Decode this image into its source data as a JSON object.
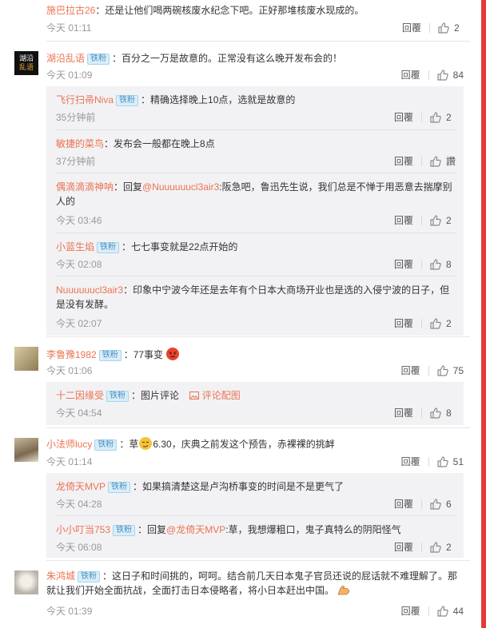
{
  "comments": [
    {
      "user": "施巴拉古26",
      "badge": "",
      "text": "：还是让他们喝两碗核废水纪念下吧。正好那堆核废水现成的。",
      "time": "今天 01:11",
      "reply_label": "回覆",
      "likes": "2"
    },
    {
      "user": "湖沿乱语",
      "badge": "铁粉",
      "avatar_text": [
        "湖沿",
        "乱语"
      ],
      "text": "：百分之一万是故意的。正常没有这么晚开发布会的！",
      "time": "今天 01:09",
      "reply_label": "回覆",
      "likes": "84",
      "replies": [
        {
          "user": "飞行扫帚Niva",
          "badge": "铁粉",
          "text": "：精确选择晚上10点，选就是故意的",
          "time": "35分钟前",
          "reply_label": "回覆",
          "likes": "2"
        },
        {
          "user": "敏捷的菜鸟",
          "badge": "",
          "text": "：发布会一般都在晚上8点",
          "time": "37分钟前",
          "reply_label": "回覆",
          "likes": "讚"
        },
        {
          "user": "偶滴滴滴神呐",
          "badge": "",
          "prefix": "：回复",
          "mention": "@Nuuuuuucl3air3",
          "text": ":阪急吧，鲁迅先生说，我们总是不惮于用恶意去揣摩别人的",
          "time": "今天 03:46",
          "reply_label": "回覆",
          "likes": "2"
        },
        {
          "user": "小蓝生焰",
          "badge": "铁粉",
          "text": "：七七事变就是22点开始的",
          "time": "今天 02:08",
          "reply_label": "回覆",
          "likes": "8"
        },
        {
          "user": "Nuuuuuucl3air3",
          "badge": "",
          "text": "：印象中宁波今年还是去年有个日本大商场开业也是选的入侵宁波的日子，但是没有发酵。",
          "time": "今天 02:07",
          "reply_label": "回覆",
          "likes": "2"
        }
      ]
    },
    {
      "user": "李鲁豫1982",
      "badge": "铁粉",
      "text": "：77事变",
      "time": "今天 01:06",
      "reply_label": "回覆",
      "likes": "75",
      "replies": [
        {
          "user": "十二因缘受",
          "badge": "铁粉",
          "text": "：图片评论",
          "pic_link": "评论配图",
          "time": "今天 04:54",
          "reply_label": "回覆",
          "likes": "8"
        }
      ]
    },
    {
      "user": "小法师lucy",
      "badge": "铁粉",
      "text_a": "：草",
      "text_b": "6.30，庆典之前发这个预告，赤裸裸的挑衅",
      "time": "今天 01:14",
      "reply_label": "回覆",
      "likes": "51",
      "replies": [
        {
          "user": "龙倚天MVP",
          "badge": "铁粉",
          "text": "：如果搞清楚这是卢沟桥事变的时间是不是更气了",
          "time": "今天 04:28",
          "reply_label": "回覆",
          "likes": "6"
        },
        {
          "user": "小小叮当753",
          "badge": "铁粉",
          "prefix": "：回复",
          "mention": "@龙倚天MVP",
          "text": ":草，我想爆粗口，鬼子真特么的阴阳怪气",
          "time": "今天 06:08",
          "reply_label": "回覆",
          "likes": "2"
        }
      ]
    },
    {
      "user": "朱鸿城",
      "badge": "铁粉",
      "text": "：这日子和时间挑的，呵呵。结合前几天日本鬼子官员还说的屁话就不难理解了。那就让我们开始全面抗战，全面打击日本侵略者，将小日本赶出中国。",
      "time": "今天 01:39",
      "reply_label": "回覆",
      "likes": "44"
    }
  ],
  "colors": {
    "username": "#eb7350",
    "badge_bg": "#d9eef8",
    "reply_box": "#f2f2f5",
    "edge": "#e63a3a"
  },
  "icons": {
    "like": "thumbs-up-icon",
    "picture": "picture-icon"
  }
}
